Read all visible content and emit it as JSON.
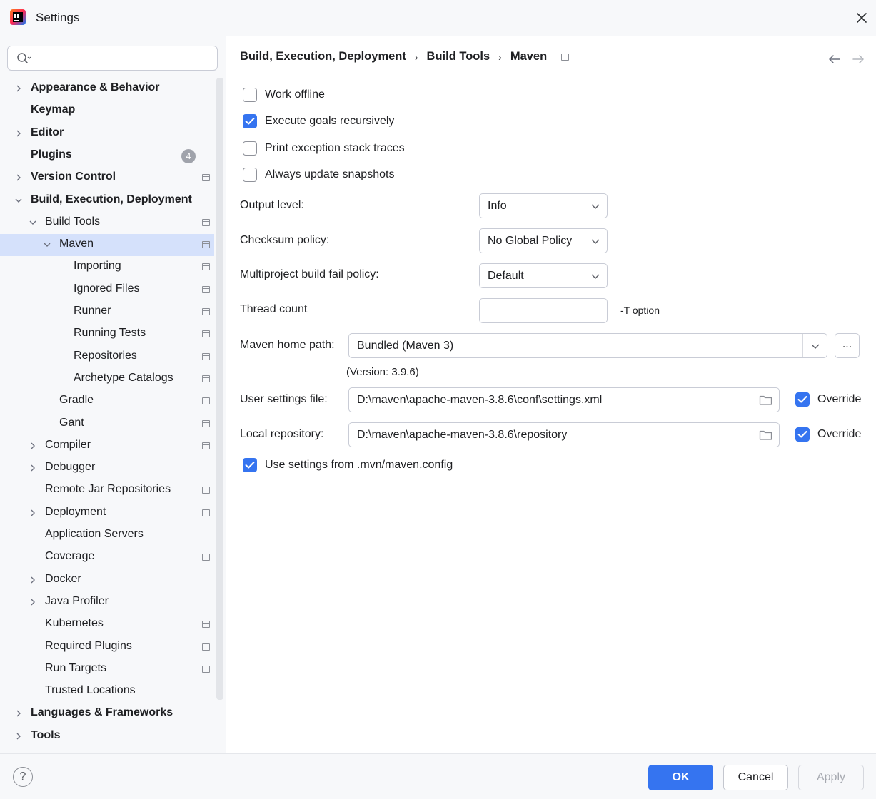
{
  "window": {
    "title": "Settings",
    "app_icon": "intellij-idea-icon"
  },
  "search": {
    "placeholder": "",
    "icon": "search-icon"
  },
  "sidebar": {
    "items": [
      {
        "label": "Appearance & Behavior",
        "bold": true,
        "level": 0,
        "expandable": true,
        "expanded": false,
        "pin": false
      },
      {
        "label": "Keymap",
        "bold": true,
        "level": 0,
        "expandable": false,
        "pin": false
      },
      {
        "label": "Editor",
        "bold": true,
        "level": 0,
        "expandable": true,
        "expanded": false,
        "pin": false
      },
      {
        "label": "Plugins",
        "bold": true,
        "level": 0,
        "expandable": false,
        "pin": false,
        "badge": "4"
      },
      {
        "label": "Version Control",
        "bold": true,
        "level": 0,
        "expandable": true,
        "expanded": false,
        "pin": true
      },
      {
        "label": "Build, Execution, Deployment",
        "bold": true,
        "level": 0,
        "expandable": true,
        "expanded": true,
        "pin": false
      },
      {
        "label": "Build Tools",
        "bold": false,
        "level": 1,
        "expandable": true,
        "expanded": true,
        "pin": true
      },
      {
        "label": "Maven",
        "bold": false,
        "level": 2,
        "expandable": true,
        "expanded": true,
        "pin": true,
        "selected": true
      },
      {
        "label": "Importing",
        "bold": false,
        "level": 3,
        "expandable": false,
        "pin": true
      },
      {
        "label": "Ignored Files",
        "bold": false,
        "level": 3,
        "expandable": false,
        "pin": true
      },
      {
        "label": "Runner",
        "bold": false,
        "level": 3,
        "expandable": false,
        "pin": true
      },
      {
        "label": "Running Tests",
        "bold": false,
        "level": 3,
        "expandable": false,
        "pin": true
      },
      {
        "label": "Repositories",
        "bold": false,
        "level": 3,
        "expandable": false,
        "pin": true
      },
      {
        "label": "Archetype Catalogs",
        "bold": false,
        "level": 3,
        "expandable": false,
        "pin": true
      },
      {
        "label": "Gradle",
        "bold": false,
        "level": 2,
        "expandable": false,
        "pin": true
      },
      {
        "label": "Gant",
        "bold": false,
        "level": 2,
        "expandable": false,
        "pin": true
      },
      {
        "label": "Compiler",
        "bold": false,
        "level": 1,
        "expandable": true,
        "expanded": false,
        "pin": true
      },
      {
        "label": "Debugger",
        "bold": false,
        "level": 1,
        "expandable": true,
        "expanded": false,
        "pin": false
      },
      {
        "label": "Remote Jar Repositories",
        "bold": false,
        "level": 1,
        "expandable": false,
        "pin": true
      },
      {
        "label": "Deployment",
        "bold": false,
        "level": 1,
        "expandable": true,
        "expanded": false,
        "pin": true
      },
      {
        "label": "Application Servers",
        "bold": false,
        "level": 1,
        "expandable": false,
        "pin": false
      },
      {
        "label": "Coverage",
        "bold": false,
        "level": 1,
        "expandable": false,
        "pin": true
      },
      {
        "label": "Docker",
        "bold": false,
        "level": 1,
        "expandable": true,
        "expanded": false,
        "pin": false
      },
      {
        "label": "Java Profiler",
        "bold": false,
        "level": 1,
        "expandable": true,
        "expanded": false,
        "pin": false
      },
      {
        "label": "Kubernetes",
        "bold": false,
        "level": 1,
        "expandable": false,
        "pin": true
      },
      {
        "label": "Required Plugins",
        "bold": false,
        "level": 1,
        "expandable": false,
        "pin": true
      },
      {
        "label": "Run Targets",
        "bold": false,
        "level": 1,
        "expandable": false,
        "pin": true
      },
      {
        "label": "Trusted Locations",
        "bold": false,
        "level": 1,
        "expandable": false,
        "pin": false
      },
      {
        "label": "Languages & Frameworks",
        "bold": true,
        "level": 0,
        "expandable": true,
        "expanded": false,
        "pin": false
      },
      {
        "label": "Tools",
        "bold": true,
        "level": 0,
        "expandable": true,
        "expanded": false,
        "pin": false
      }
    ]
  },
  "breadcrumb": {
    "items": [
      "Build, Execution, Deployment",
      "Build Tools",
      "Maven"
    ],
    "separator": "›"
  },
  "options": {
    "work_offline": {
      "label": "Work offline",
      "checked": false
    },
    "execute_recursively": {
      "label": "Execute goals recursively",
      "checked": true
    },
    "print_stack_traces": {
      "label": "Print exception stack traces",
      "checked": false
    },
    "always_update": {
      "label": "Always update snapshots",
      "checked": false
    },
    "use_mvn_config": {
      "label": "Use settings from .mvn/maven.config",
      "checked": true
    }
  },
  "fields": {
    "output_level": {
      "label": "Output level:",
      "value": "Info"
    },
    "checksum_policy": {
      "label": "Checksum policy:",
      "value": "No Global Policy"
    },
    "fail_policy": {
      "label": "Multiproject build fail policy:",
      "value": "Default"
    },
    "thread_count": {
      "label": "Thread count",
      "value": "",
      "hint": "-T option"
    },
    "maven_home": {
      "label": "Maven home path:",
      "value": "Bundled (Maven 3)",
      "version": "(Version: 3.9.6)",
      "browse": "..."
    },
    "user_settings": {
      "label": "User settings file:",
      "value": "D:\\maven\\apache-maven-3.8.6\\conf\\settings.xml",
      "override_label": "Override",
      "override": true
    },
    "local_repo": {
      "label": "Local repository:",
      "value": "D:\\maven\\apache-maven-3.8.6\\repository",
      "override_label": "Override",
      "override": true
    }
  },
  "footer": {
    "help": "?",
    "ok": "OK",
    "cancel": "Cancel",
    "apply": "Apply"
  },
  "colors": {
    "accent": "#3574f0",
    "selection": "#d5e1fb",
    "sidebar_bg": "#f7f8fa",
    "content_bg": "#ffffff"
  }
}
